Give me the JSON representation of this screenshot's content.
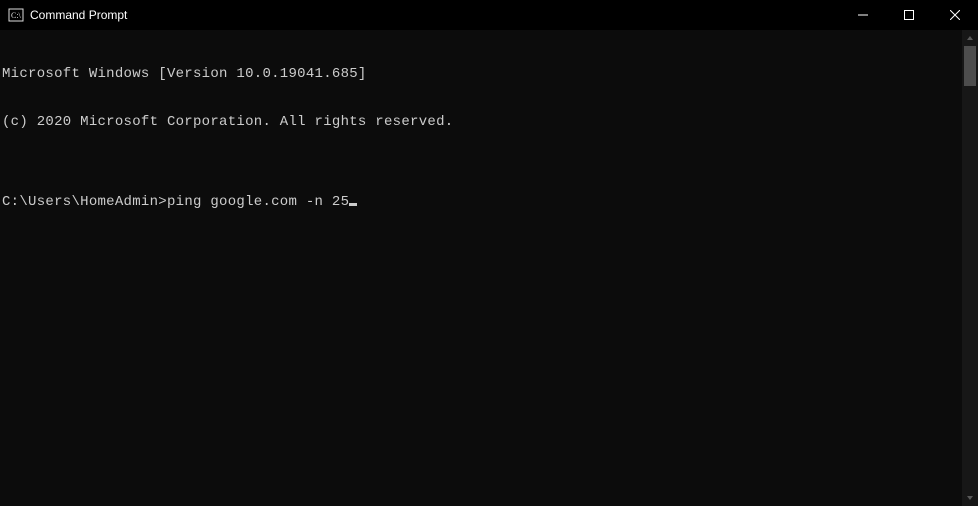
{
  "window": {
    "title": "Command Prompt"
  },
  "terminal": {
    "line1": "Microsoft Windows [Version 10.0.19041.685]",
    "line2": "(c) 2020 Microsoft Corporation. All rights reserved.",
    "blank": "",
    "prompt": "C:\\Users\\HomeAdmin>",
    "command": "ping google.com -n 25"
  }
}
